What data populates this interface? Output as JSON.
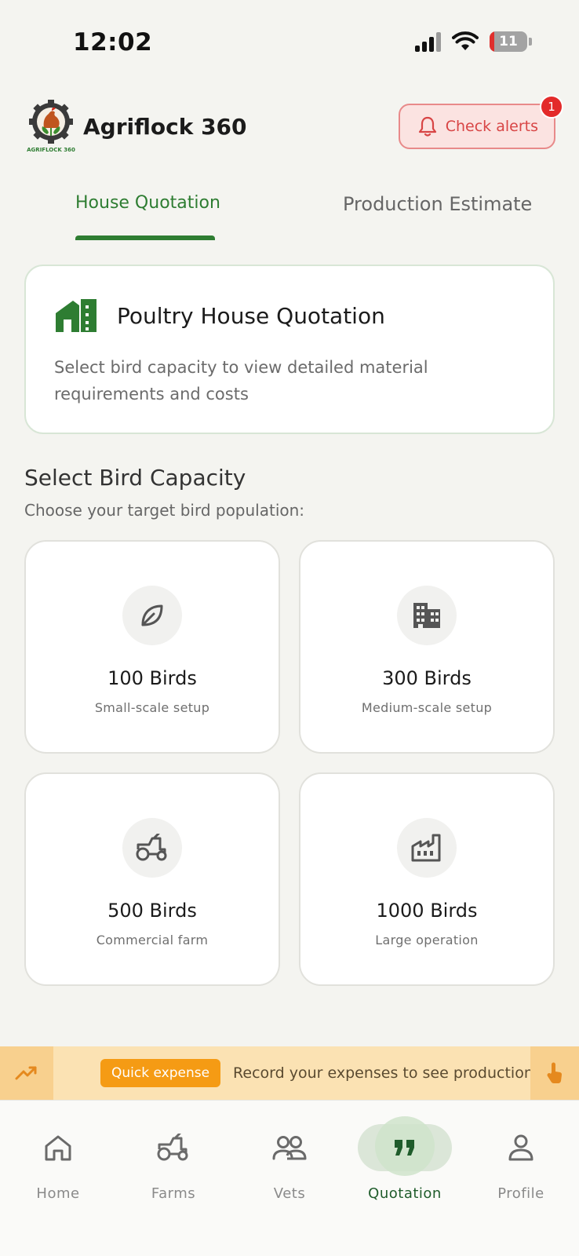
{
  "status_bar": {
    "time": "12:02",
    "battery": "11"
  },
  "header": {
    "app_title": "Agriflock 360",
    "logo_text": "AGRIFLOCK 360",
    "alert_label": "Check alerts",
    "alert_count": "1"
  },
  "tabs": [
    {
      "label": "House Quotation",
      "active": true
    },
    {
      "label": "Production Estimate",
      "active": false
    }
  ],
  "intro": {
    "title": "Poultry House Quotation",
    "description": "Select bird capacity to view detailed material requirements and costs"
  },
  "capacity_section": {
    "title": "Select Bird Capacity",
    "subtitle": "Choose your target bird population:"
  },
  "capacities": [
    {
      "title": "100 Birds",
      "subtitle": "Small-scale setup",
      "icon": "leaf-icon"
    },
    {
      "title": "300 Birds",
      "subtitle": "Medium-scale setup",
      "icon": "building-icon"
    },
    {
      "title": "500 Birds",
      "subtitle": "Commercial farm",
      "icon": "tractor-icon"
    },
    {
      "title": "1000 Birds",
      "subtitle": "Large operation",
      "icon": "factory-icon"
    }
  ],
  "banner": {
    "chip": "Quick expense",
    "text": "Record your expenses to see production"
  },
  "bottom_nav": [
    {
      "label": "Home",
      "icon": "home-icon"
    },
    {
      "label": "Farms",
      "icon": "tractor-icon"
    },
    {
      "label": "Vets",
      "icon": "people-icon"
    },
    {
      "label": "Quotation",
      "icon": "quote-icon",
      "active": true
    },
    {
      "label": "Profile",
      "icon": "person-icon"
    }
  ],
  "colors": {
    "primary_green": "#2e7d32",
    "alert_red": "#d84545",
    "banner_orange": "#f59b14",
    "background": "#f4f4f0"
  }
}
